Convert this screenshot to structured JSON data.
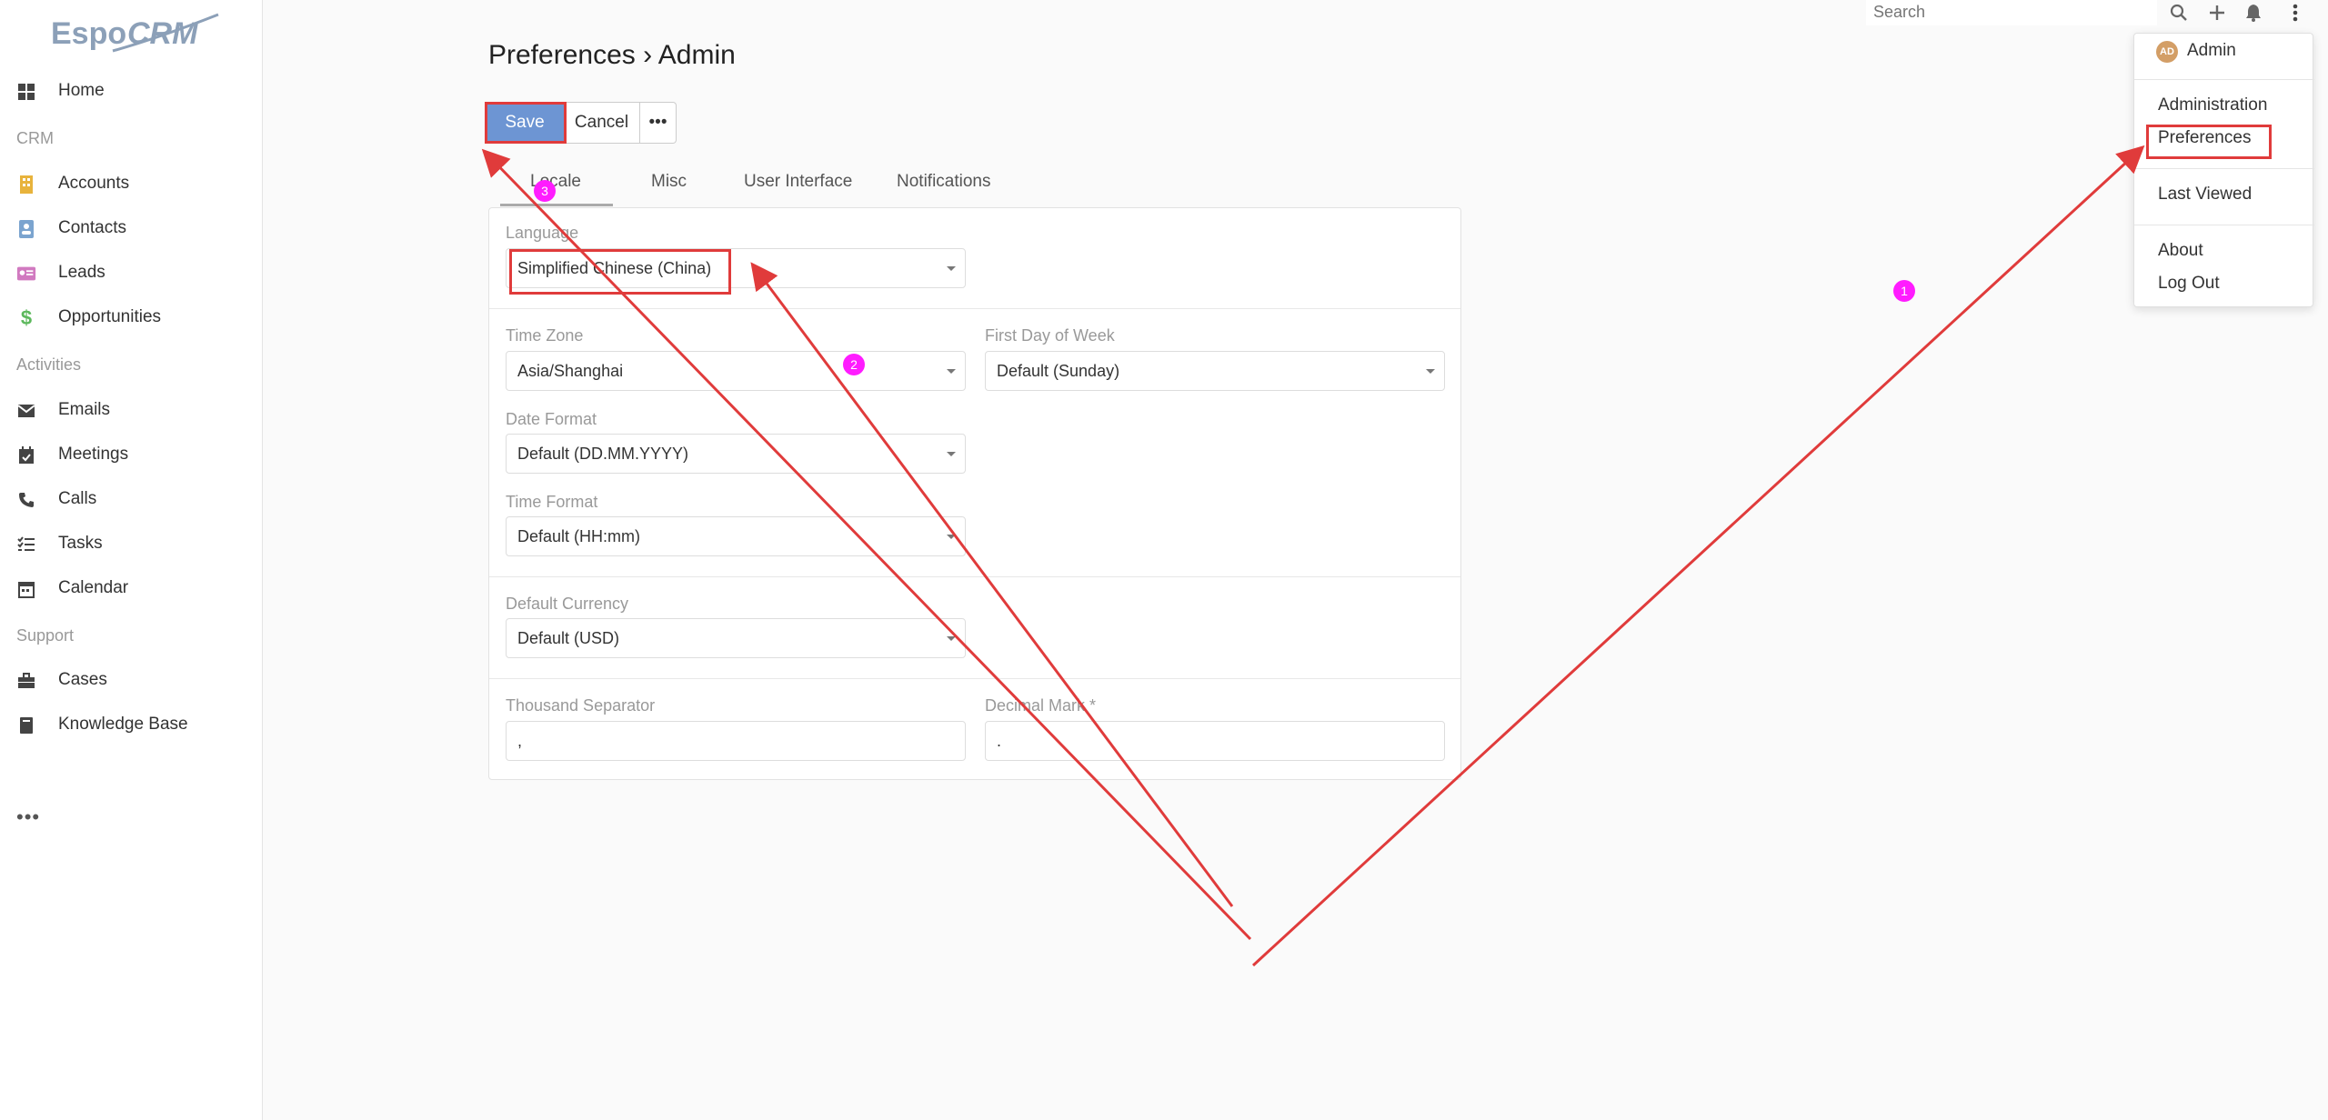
{
  "app": {
    "logo_text": "EspoCRM"
  },
  "sidebar": {
    "items": [
      {
        "label": "Home",
        "icon": "home-grid-icon"
      },
      {
        "group": "CRM"
      },
      {
        "label": "Accounts",
        "icon": "building-icon"
      },
      {
        "label": "Contacts",
        "icon": "contact-card-icon"
      },
      {
        "label": "Leads",
        "icon": "id-card-icon"
      },
      {
        "label": "Opportunities",
        "icon": "dollar-icon"
      },
      {
        "group": "Activities"
      },
      {
        "label": "Emails",
        "icon": "envelope-icon"
      },
      {
        "label": "Meetings",
        "icon": "calendar-check-icon"
      },
      {
        "label": "Calls",
        "icon": "phone-icon"
      },
      {
        "label": "Tasks",
        "icon": "tasks-icon"
      },
      {
        "label": "Calendar",
        "icon": "calendar-icon"
      },
      {
        "group": "Support"
      },
      {
        "label": "Cases",
        "icon": "briefcase-icon"
      },
      {
        "label": "Knowledge Base",
        "icon": "book-icon"
      }
    ],
    "more": "•••"
  },
  "topbar": {
    "search_placeholder": "Search"
  },
  "menu": {
    "user": "Admin",
    "avatar_initials": "AD",
    "administration": "Administration",
    "preferences": "Preferences",
    "last_viewed": "Last Viewed",
    "about": "About",
    "logout": "Log Out"
  },
  "page": {
    "title": "Preferences › Admin"
  },
  "buttons": {
    "save": "Save",
    "cancel": "Cancel",
    "more": "•••"
  },
  "tabs": [
    "Locale",
    "Misc",
    "User Interface",
    "Notifications"
  ],
  "form": {
    "language": {
      "label": "Language",
      "value": "Simplified Chinese (China)"
    },
    "time_zone": {
      "label": "Time Zone",
      "value": "Asia/Shanghai"
    },
    "first_day_of_week": {
      "label": "First Day of Week",
      "value": "Default (Sunday)"
    },
    "date_format": {
      "label": "Date Format",
      "value": "Default (DD.MM.YYYY)"
    },
    "time_format": {
      "label": "Time Format",
      "value": "Default (HH:mm)"
    },
    "default_currency": {
      "label": "Default Currency",
      "value": "Default (USD)"
    },
    "thousand_separator": {
      "label": "Thousand Separator",
      "value": ","
    },
    "decimal_mark": {
      "label": "Decimal Mark *",
      "value": "."
    }
  },
  "annotations": {
    "step1": "1",
    "step2": "2",
    "step3": "3",
    "color": "#e03b3b",
    "badge_color": "#ff1cff"
  }
}
